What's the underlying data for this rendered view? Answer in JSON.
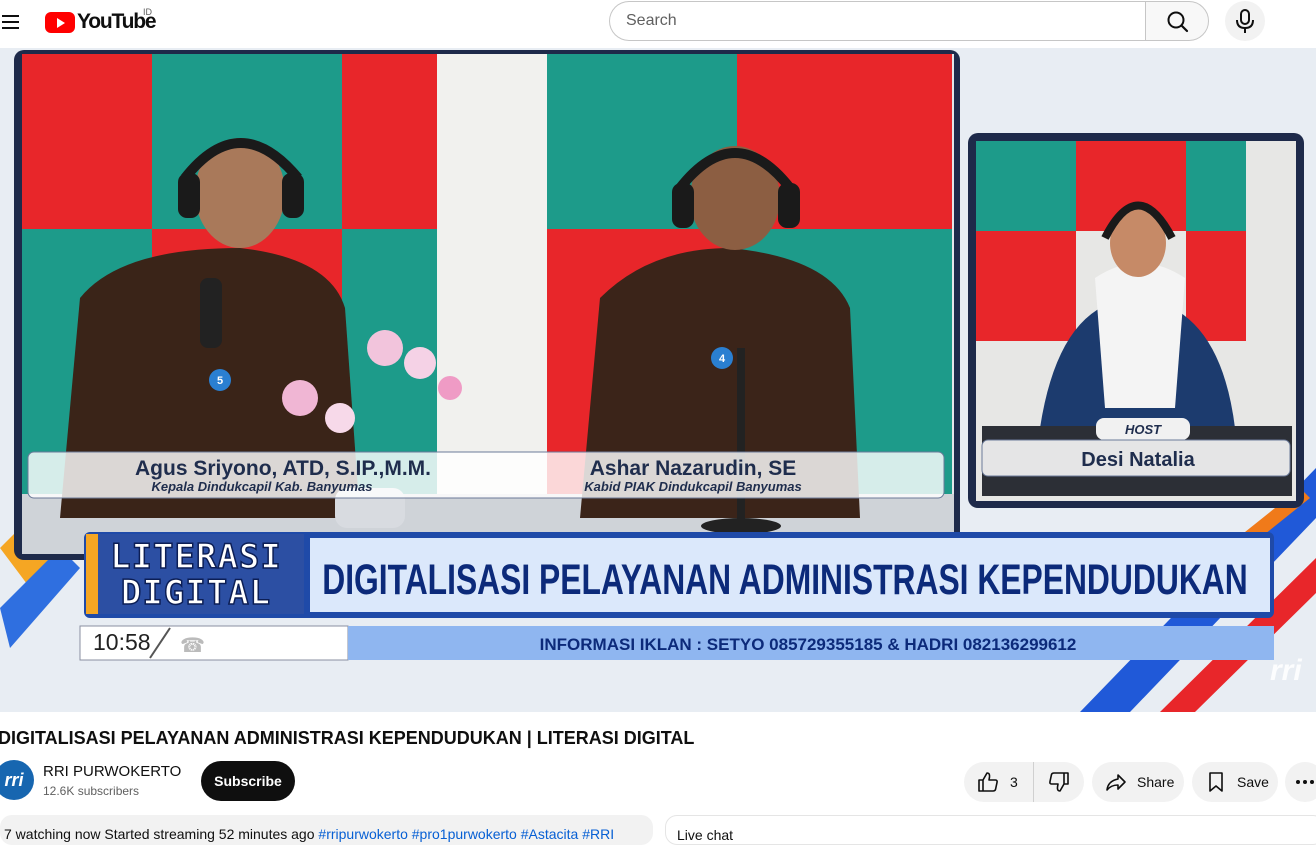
{
  "header": {
    "logo_text": "YouTube",
    "country_code": "ID",
    "search_placeholder": "Search"
  },
  "video": {
    "guest1_name": "Agus Sriyono, ATD, S.IP.,M.M.",
    "guest1_title": "Kepala Dindukcapil Kab. Banyumas",
    "guest2_name": "Ashar Nazarudin, SE",
    "guest2_title": "Kabid PIAK Dindukcapil Banyumas",
    "host_label": "HOST",
    "host_name": "Desi Natalia",
    "program_line1": "LITERASI",
    "program_line2": "DIGITAL",
    "topic": "DIGITALISASI PELAYANAN ADMINISTRASI KEPENDUDUKAN",
    "clock": "10:58",
    "ticker": "INFORMASI IKLAN : SETYO 085729355185 & HADRI 082136299612",
    "mic_number_1": "5",
    "mic_number_2": "4",
    "brand_watermark": "rri"
  },
  "info": {
    "title": "DIGITALISASI PELAYANAN ADMINISTRASI KEPENDUDUKAN | LITERASI DIGITAL",
    "channel_name": "RRI PURWOKERTO",
    "channel_avatar_text": "rri",
    "subscribers": "12.6K subscribers",
    "subscribe_label": "Subscribe",
    "like_count": "3",
    "share_label": "Share",
    "save_label": "Save",
    "description_text": "7 watching now  Started streaming 52 minutes ago  ",
    "description_tags": "#rripurwokerto #pro1purwokerto #Astacita #RRI",
    "live_chat_label": "Live chat"
  },
  "colors": {
    "brand_red": "#ff0000",
    "subscribe_bg": "#0f0f0f",
    "banner_blue": "#1f4aa8",
    "set_red": "#e8262a",
    "set_teal": "#1d9b8a"
  }
}
